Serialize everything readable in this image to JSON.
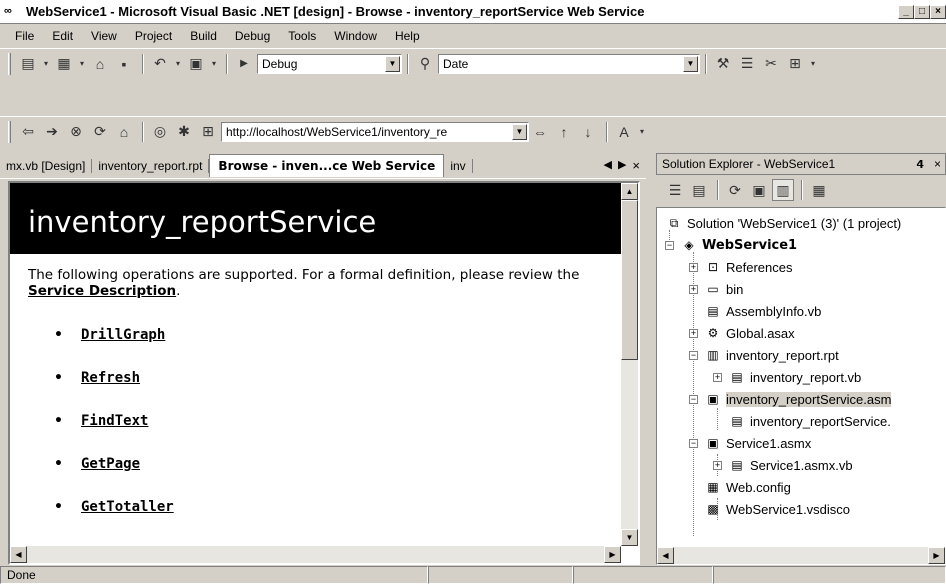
{
  "window": {
    "title": "WebService1 - Microsoft Visual Basic .NET [design] - Browse - inventory_reportService Web Service",
    "app_icon": "∞",
    "minimize": "_",
    "maximize": "□",
    "close": "×"
  },
  "menu": [
    "File",
    "Edit",
    "View",
    "Project",
    "Build",
    "Debug",
    "Tools",
    "Window",
    "Help"
  ],
  "toolbar1": {
    "config_value": "Debug",
    "find_value": "Date"
  },
  "toolbar2": {
    "url": "http://localhost/WebService1/inventory_re"
  },
  "doc_tabs": {
    "tab1": "mx.vb [Design]",
    "tab2": "inventory_report.rpt",
    "tab3": "Browse - inven...ce Web Service",
    "tab4": "inv",
    "left": "◀",
    "right": "▶",
    "close": "×"
  },
  "browser": {
    "header": "inventory_reportService",
    "intro_prefix": "The following operations are supported. For a formal definition, please review the ",
    "intro_link": "Service Description",
    "intro_suffix": ".",
    "operations": [
      "DrillGraph",
      "Refresh",
      "FindText",
      "GetPage",
      "GetTotaller"
    ]
  },
  "solution_explorer": {
    "title": "Solution Explorer - WebService1",
    "pin": "ᵖ",
    "close": "×",
    "nodes": [
      {
        "label": "Solution 'WebService1 (3)' (1 project)"
      },
      {
        "label": "WebService1"
      },
      {
        "label": "References"
      },
      {
        "label": "bin"
      },
      {
        "label": "AssemblyInfo.vb"
      },
      {
        "label": "Global.asax"
      },
      {
        "label": "inventory_report.rpt"
      },
      {
        "label": "inventory_report.vb"
      },
      {
        "label": "inventory_reportService.asm"
      },
      {
        "label": "inventory_reportService."
      },
      {
        "label": "Service1.asmx"
      },
      {
        "label": "Service1.asmx.vb"
      },
      {
        "label": "Web.config"
      },
      {
        "label": "WebService1.vsdisco"
      }
    ]
  },
  "status": {
    "text": "Done"
  }
}
